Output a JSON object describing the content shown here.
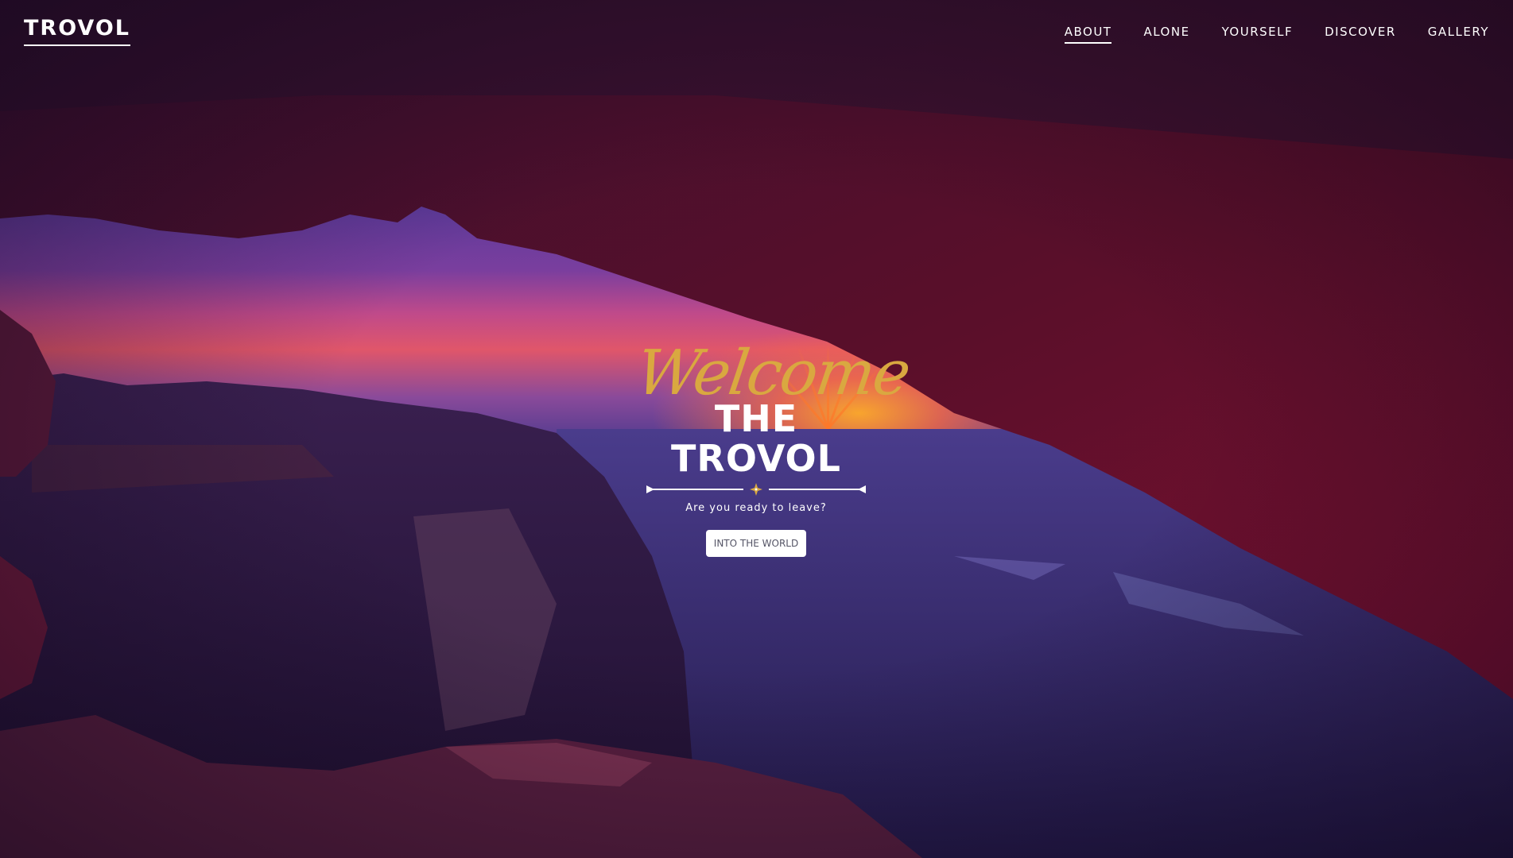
{
  "site": {
    "logo": "TROVOL"
  },
  "nav": {
    "items": [
      {
        "label": "ABOUT",
        "active": true
      },
      {
        "label": "ALONE",
        "active": false
      },
      {
        "label": "YOURSELF",
        "active": false
      },
      {
        "label": "DISCOVER",
        "active": false
      },
      {
        "label": "GALLERY",
        "active": false
      }
    ]
  },
  "hero": {
    "script_title": "Welcome",
    "title": "THE TROVOL",
    "subtitle": "Are you ready to leave?",
    "cta_label": "INTO THE WORLD",
    "divider_icon": "compass-star-icon"
  },
  "colors": {
    "script_gold": "#d9a840",
    "text": "#ffffff",
    "button_bg": "#ffffff",
    "button_text": "#555566",
    "rock_dark": "#3a0f2e",
    "sky_glow": "#e0566a"
  }
}
